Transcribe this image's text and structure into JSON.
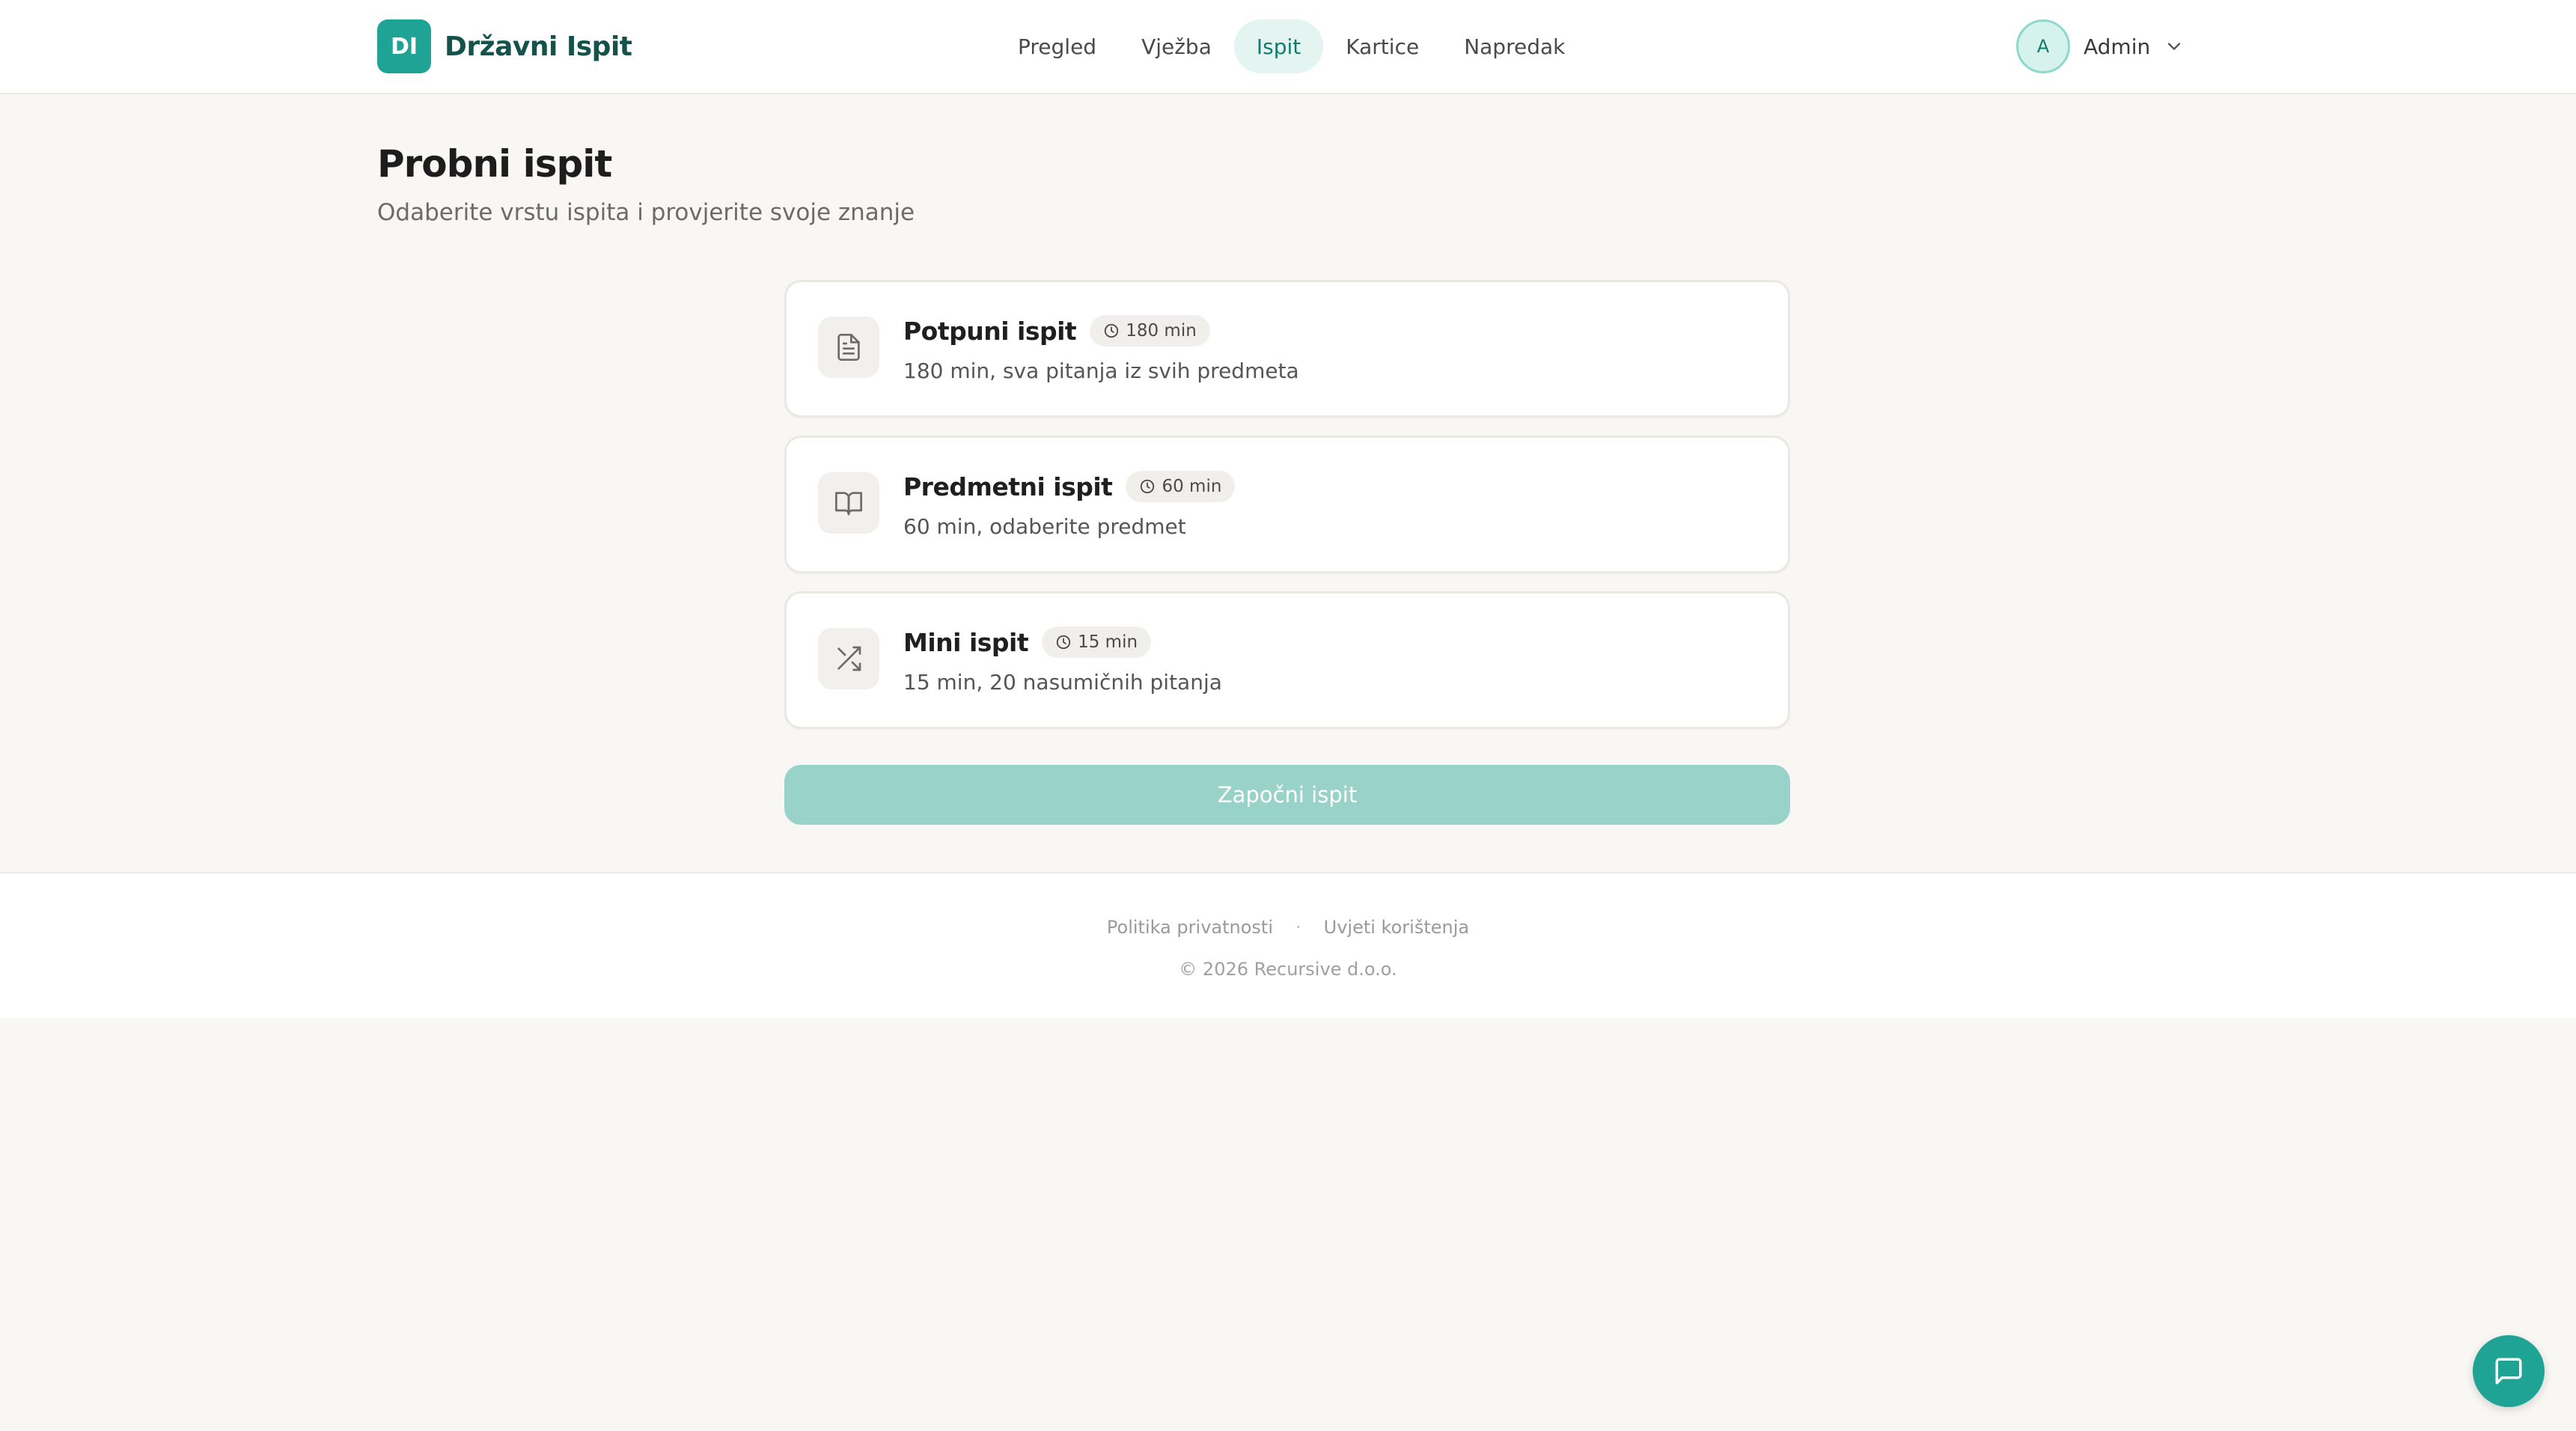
{
  "app": {
    "logo_badge": "DI",
    "logo_text": "Državni Ispit"
  },
  "nav": {
    "items": [
      {
        "label": "Pregled",
        "active": false
      },
      {
        "label": "Vježba",
        "active": false
      },
      {
        "label": "Ispit",
        "active": true
      },
      {
        "label": "Kartice",
        "active": false
      },
      {
        "label": "Napredak",
        "active": false
      }
    ]
  },
  "user": {
    "avatar_initial": "A",
    "name": "Admin"
  },
  "page": {
    "title": "Probni ispit",
    "subtitle": "Odaberite vrstu ispita i provjerite svoje znanje"
  },
  "exams": [
    {
      "title": "Potpuni ispit",
      "badge": "180 min",
      "desc": "180 min, sva pitanja iz svih predmeta",
      "icon": "document-icon"
    },
    {
      "title": "Predmetni ispit",
      "badge": "60 min",
      "desc": "60 min, odaberite predmet",
      "icon": "book-open-icon"
    },
    {
      "title": "Mini ispit",
      "badge": "15 min",
      "desc": "15 min, 20 nasumičnih pitanja",
      "icon": "shuffle-icon"
    }
  ],
  "start_button": "Započni ispit",
  "footer": {
    "privacy": "Politika privatnosti",
    "separator": "·",
    "terms": "Uvjeti korištenja",
    "copyright": "© 2026 Recursive d.o.o."
  },
  "colors": {
    "brand": "#1fa394",
    "brand_dark": "#14524b",
    "nav_active_bg": "#e3f4f1",
    "button_disabled": "#99d2c8"
  }
}
